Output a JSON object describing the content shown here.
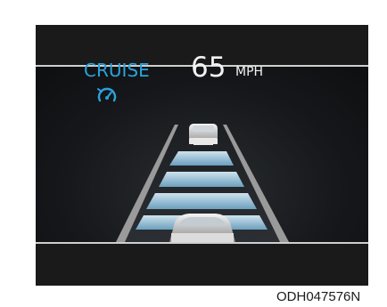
{
  "cluster": {
    "cruise_label": "CRUISE",
    "set_speed": "65",
    "speed_unit": "MPH",
    "accent_color": "#2aa3dc"
  },
  "icons": {
    "cruise": "cruise-speedometer-icon",
    "lead_vehicle": "lead-car-icon",
    "own_vehicle": "own-car-icon"
  },
  "caption": {
    "code": "ODH047576N"
  }
}
